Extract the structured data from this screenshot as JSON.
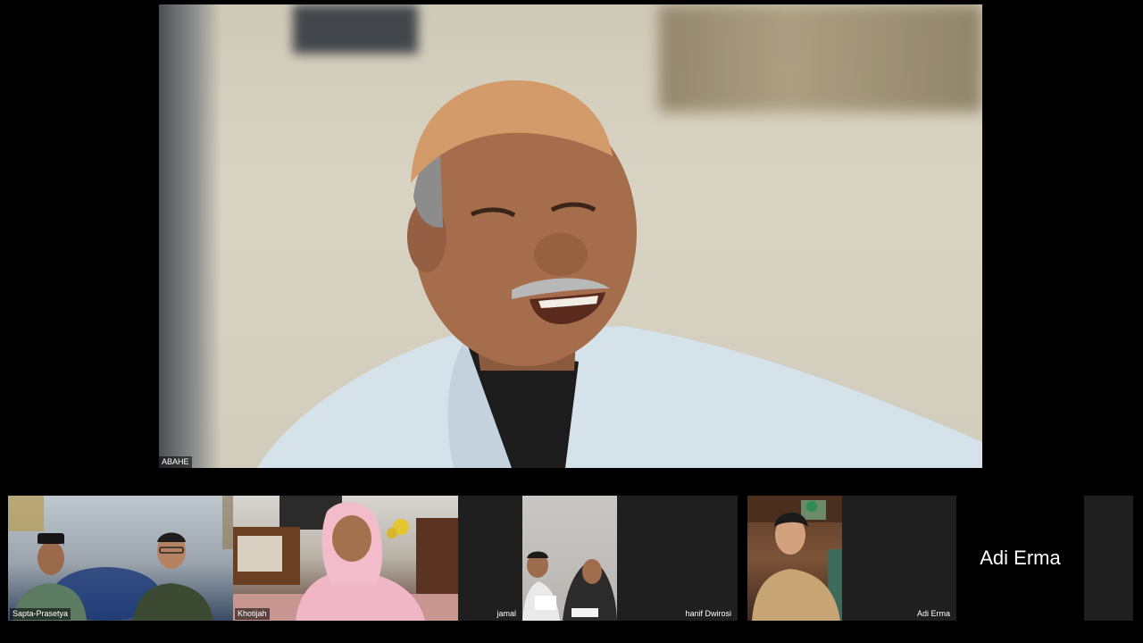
{
  "meeting": {
    "main_speaker": {
      "name": "ABAHE"
    },
    "participants": [
      {
        "name": "Sapta-Prasetya",
        "video": "on"
      },
      {
        "name": "Khotijah",
        "video": "on"
      },
      {
        "name": "jamal",
        "video": "off"
      },
      {
        "name": "hanif Dwirosi",
        "video": "on"
      },
      {
        "name": "Adi Erma",
        "video": "on"
      },
      {
        "name": "Adi Erma",
        "video": "off"
      }
    ]
  },
  "colors": {
    "background": "#000000",
    "tile_off": "#1f1f1f",
    "name_text": "#ffffff"
  }
}
